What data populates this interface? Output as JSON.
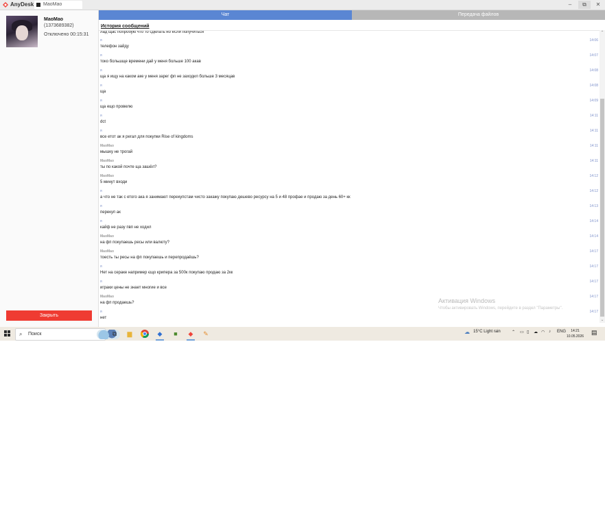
{
  "titlebar": {
    "app_name": "AnyDesk",
    "tab_label": "MaoMao",
    "logo_color": "#ef443b",
    "controls": {
      "minimize": "–",
      "maximize": "⧉",
      "close": "✕"
    }
  },
  "contact": {
    "name": "MaoMao",
    "id": "(1373689382)",
    "status": "Отключено 00:15:31"
  },
  "close_label": "Закрыть",
  "tabs": {
    "chat": "Чат",
    "files": "Передача файлов"
  },
  "history_title": "История сообщений",
  "first_line": "лад щас попробую что то сделать но если получиться",
  "messages": [
    {
      "sender": "я",
      "time": "14:06",
      "text": "телефон зайду"
    },
    {
      "sender": "я",
      "time": "14:07",
      "text": "токо большще времени дай у меня больше 100 акав"
    },
    {
      "sender": "я",
      "time": "14:08",
      "text": "ща я ищу на каком аке у меня зарег фп не заходил больше 3 месяцав"
    },
    {
      "sender": "я",
      "time": "14:08",
      "text": "ща"
    },
    {
      "sender": "я",
      "time": "14:09",
      "text": "ща ещо провелю"
    },
    {
      "sender": "я",
      "time": "14:11",
      "text": "dct"
    },
    {
      "sender": "я",
      "time": "14:11",
      "text": "все етот ак я регал для покупки Rise of kingdoms"
    },
    {
      "sender": "MaoMao",
      "time": "14:11",
      "text": "мышку не трогай"
    },
    {
      "sender": "MaoMao",
      "time": "14:11",
      "text": "ты по какой почте ща зашёл?"
    },
    {
      "sender": "MaoMao",
      "time": "14:12",
      "text": "5 минут входи"
    },
    {
      "sender": "я",
      "time": "14:12",
      "text": "а что не так с етого ака я занимают перекупстам чисто закажу покупаю дешево ресурсу на 5 и 48 профае и продаю за день 60+ кк"
    },
    {
      "sender": "я",
      "time": "14:13",
      "text": "перекуп ак"
    },
    {
      "sender": "я",
      "time": "14:14",
      "text": "кайф не разу пвп не ходил"
    },
    {
      "sender": "MaoMao",
      "time": "14:14",
      "text": "на фп покупаешь ресы или валюту?"
    },
    {
      "sender": "MaoMao",
      "time": "14:17",
      "text": "тоесть ты ресы на фп покупаешь и перепродаёшь?"
    },
    {
      "sender": "я",
      "time": "14:17",
      "text": "Нет на сераке например єщо крипера за 500к покупаю продаю за 2кк"
    },
    {
      "sender": "я",
      "time": "14:17",
      "text": "играки цены не знает многие и все"
    },
    {
      "sender": "MaoMao",
      "time": "14:17",
      "text": "на фп продаешь?"
    },
    {
      "sender": "я",
      "time": "14:17",
      "text": "нет"
    }
  ],
  "watermark": {
    "title": "Активация Windows",
    "subtitle": "Чтобы активировать Windows, перейдите в раздел \"Параметры\"."
  },
  "taskbar": {
    "search_placeholder": "Поиск",
    "weather": "15°C  Light rain",
    "language": "ENG",
    "time": "14:21",
    "date": "10.05.2026",
    "apps": [
      "task-view-icon",
      "file-explorer-icon",
      "chrome-icon",
      "anydesk-blue-icon",
      "minecraft-icon",
      "anydesk-red-icon",
      "paint-icon"
    ]
  }
}
